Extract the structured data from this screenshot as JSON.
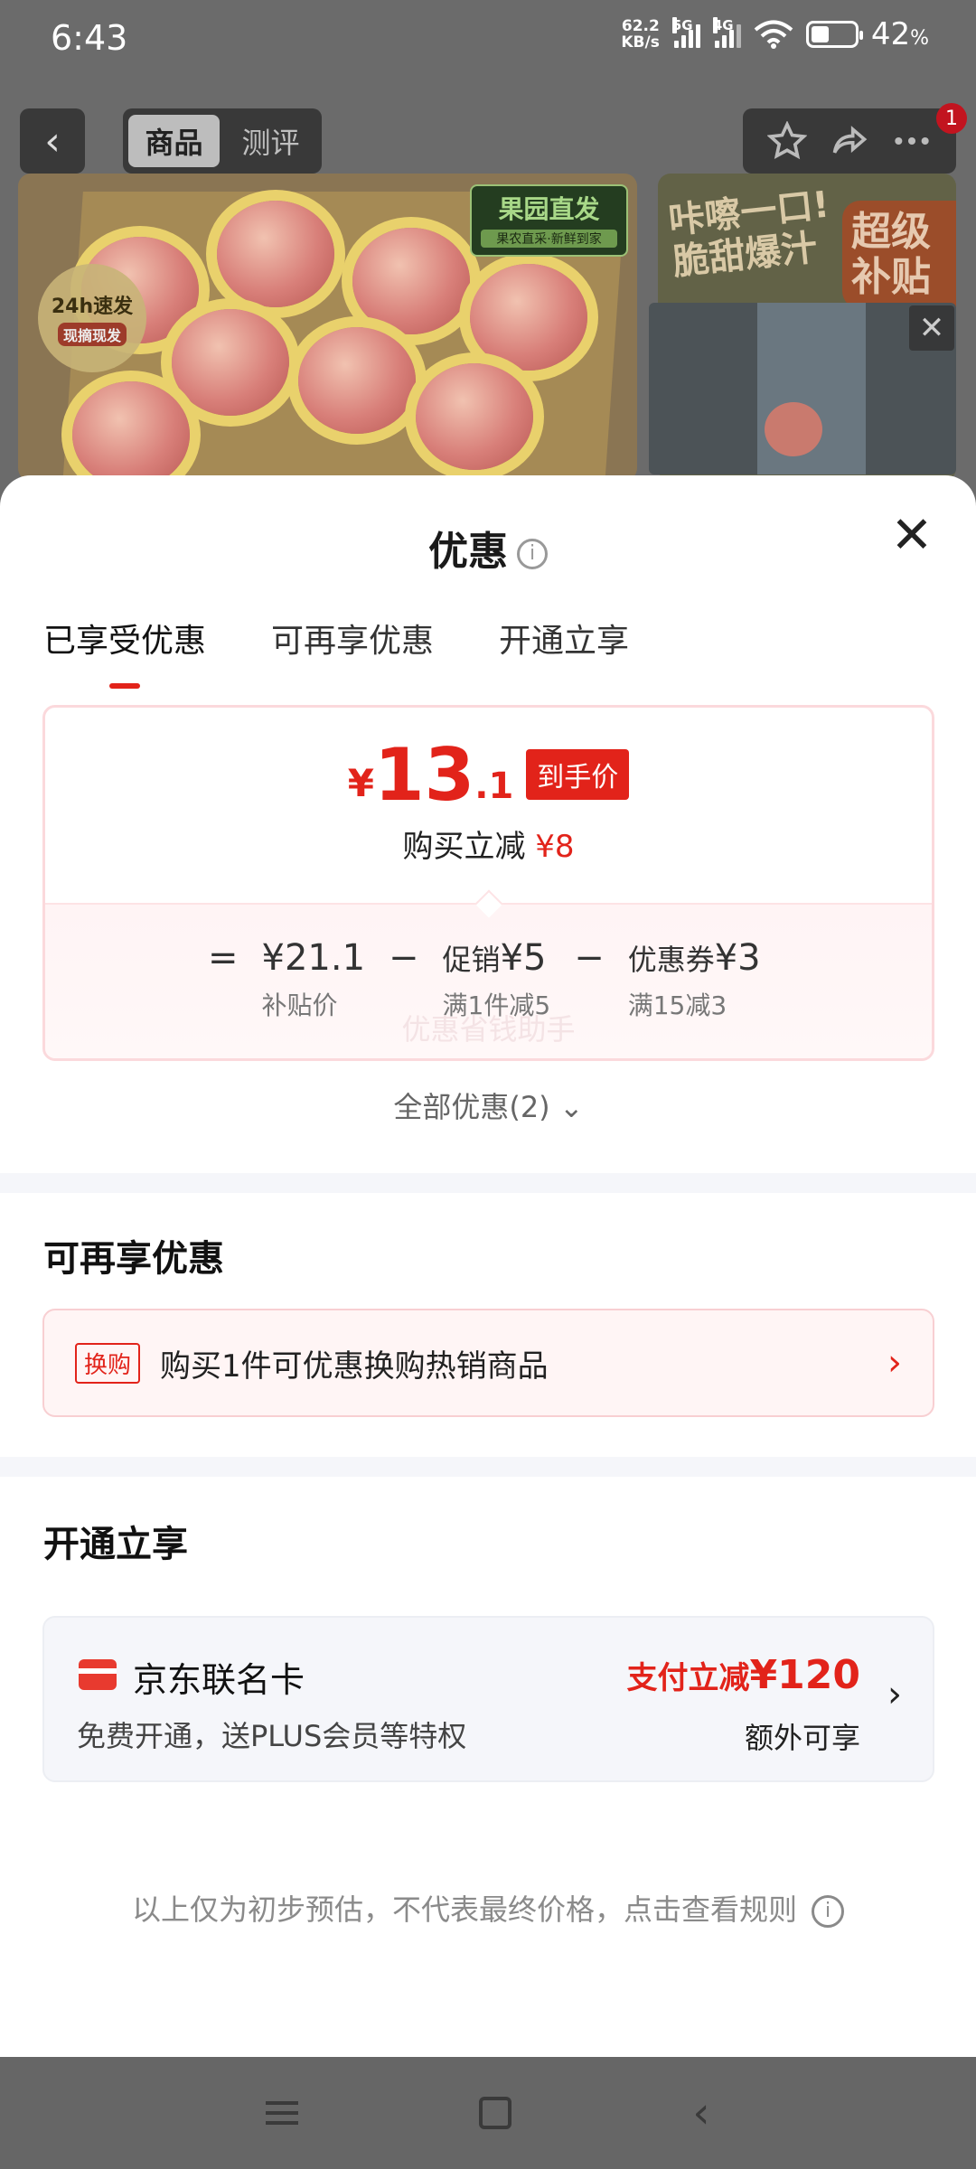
{
  "status": {
    "time": "6:43",
    "net_speed_value": "62.2",
    "net_speed_unit": "KB/s",
    "sim1_tag": "5G",
    "sim2_tag": "4G",
    "battery_percent": "42",
    "battery_suffix": "%",
    "battery_level": 0.42
  },
  "product_header": {
    "tabs": [
      "商品",
      "测评"
    ],
    "active_tab": "商品",
    "cart_badge": "1"
  },
  "banner": {
    "speed_tag": "24h速发",
    "speed_sub": "现摘现发",
    "orchard_title": "果园直发",
    "orchard_sub": "果农直采·新鲜到家",
    "promo_text": "咔嚓一口!脆甜爆汁",
    "super_subsidy": "超级补贴"
  },
  "sheet": {
    "title": "优惠",
    "tabs": [
      {
        "label": "已享受优惠",
        "active": true
      },
      {
        "label": "可再享优惠",
        "active": false
      },
      {
        "label": "开通立享",
        "active": false
      }
    ],
    "price": {
      "currency": "¥",
      "integer": "13",
      "decimal": ".1",
      "tag": "到手价",
      "reduce_label": "购买立减",
      "reduce_value": "¥8"
    },
    "formula": {
      "equals": "=",
      "base_value": "¥21.1",
      "base_label": "补贴价",
      "minus": "−",
      "promo_label": "促销",
      "promo_value": "¥5",
      "promo_rule": "满1件减5",
      "coupon_label": "优惠券",
      "coupon_value": "¥3",
      "coupon_rule": "满15减3"
    },
    "watermark": "优惠省钱助手",
    "all_promos": "全部优惠(2)",
    "section_more": {
      "title": "可再享优惠",
      "swap_tag": "换购",
      "swap_text": "购买1件可优惠换购热销商品"
    },
    "section_open": {
      "title": "开通立享",
      "card_name": "京东联名卡",
      "card_desc": "免费开通，送PLUS会员等特权",
      "pay_reduce_label": "支付立减",
      "pay_reduce_amount": "¥120",
      "extra_label": "额外可享"
    },
    "footnote": "以上仅为初步预估，不代表最终价格，点击查看规则"
  },
  "colors": {
    "accent_red": "#e2231a",
    "overlay_dim": "#6b6b6b"
  }
}
